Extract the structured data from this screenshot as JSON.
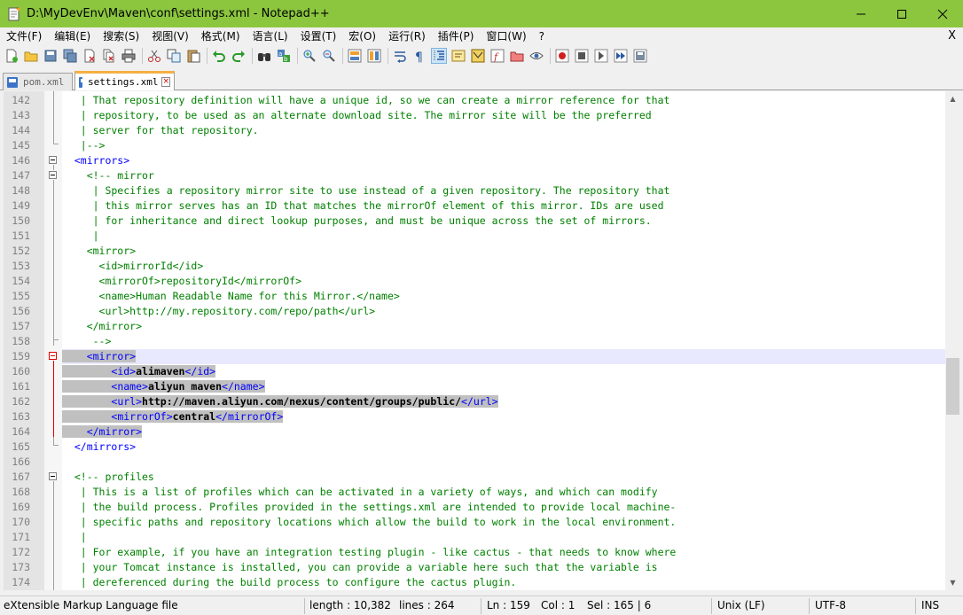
{
  "window": {
    "title": "D:\\MyDevEnv\\Maven\\conf\\settings.xml - Notepad++"
  },
  "menu": [
    "文件(F)",
    "编辑(E)",
    "搜索(S)",
    "视图(V)",
    "格式(M)",
    "语言(L)",
    "设置(T)",
    "宏(O)",
    "运行(R)",
    "插件(P)",
    "窗口(W)",
    "?"
  ],
  "menu_close": "X",
  "tabs": [
    {
      "label": "pom.xml",
      "active": false
    },
    {
      "label": "settings.xml",
      "active": true
    }
  ],
  "lines": [
    {
      "n": "142",
      "s": [
        [
          "c",
          "   | That repository definition will have a unique id, so we can create a mirror reference for that"
        ]
      ]
    },
    {
      "n": "143",
      "s": [
        [
          "c",
          "   | repository, to be used as an alternate download site. The mirror site will be the preferred"
        ]
      ]
    },
    {
      "n": "144",
      "s": [
        [
          "c",
          "   | server for that repository."
        ]
      ]
    },
    {
      "n": "145",
      "s": [
        [
          "c",
          "   |-->"
        ]
      ]
    },
    {
      "n": "146",
      "s": [
        [
          "t",
          "  <mirrors>"
        ]
      ]
    },
    {
      "n": "147",
      "s": [
        [
          "c",
          "    <!-- mirror"
        ]
      ]
    },
    {
      "n": "148",
      "s": [
        [
          "c",
          "     | Specifies a repository mirror site to use instead of a given repository. The repository that"
        ]
      ]
    },
    {
      "n": "149",
      "s": [
        [
          "c",
          "     | this mirror serves has an ID that matches the mirrorOf element of this mirror. IDs are used"
        ]
      ]
    },
    {
      "n": "150",
      "s": [
        [
          "c",
          "     | for inheritance and direct lookup purposes, and must be unique across the set of mirrors."
        ]
      ]
    },
    {
      "n": "151",
      "s": [
        [
          "c",
          "     |"
        ]
      ]
    },
    {
      "n": "152",
      "s": [
        [
          "c",
          "    <mirror>"
        ]
      ]
    },
    {
      "n": "153",
      "s": [
        [
          "c",
          "      <id>mirrorId</id>"
        ]
      ]
    },
    {
      "n": "154",
      "s": [
        [
          "c",
          "      <mirrorOf>repositoryId</mirrorOf>"
        ]
      ]
    },
    {
      "n": "155",
      "s": [
        [
          "c",
          "      <name>Human Readable Name for this Mirror.</name>"
        ]
      ]
    },
    {
      "n": "156",
      "s": [
        [
          "c",
          "      <url>http://my.repository.com/repo/path</url>"
        ]
      ]
    },
    {
      "n": "157",
      "s": [
        [
          "c",
          "    </mirror>"
        ]
      ]
    },
    {
      "n": "158",
      "s": [
        [
          "c",
          "     -->"
        ]
      ]
    },
    {
      "n": "159",
      "current": true,
      "sel": true,
      "s": [
        [
          "p",
          "    "
        ],
        [
          "t",
          "<mirror>"
        ]
      ]
    },
    {
      "n": "160",
      "sel": true,
      "s": [
        [
          "p",
          "        "
        ],
        [
          "t",
          "<id>"
        ],
        [
          "x",
          "alimaven"
        ],
        [
          "t",
          "</id>"
        ]
      ]
    },
    {
      "n": "161",
      "sel": true,
      "s": [
        [
          "p",
          "        "
        ],
        [
          "t",
          "<name>"
        ],
        [
          "x",
          "aliyun maven"
        ],
        [
          "t",
          "</name>"
        ]
      ]
    },
    {
      "n": "162",
      "sel": true,
      "s": [
        [
          "p",
          "        "
        ],
        [
          "t",
          "<url>"
        ],
        [
          "x",
          "http://maven.aliyun.com/nexus/content/groups/public/"
        ],
        [
          "t",
          "</url>"
        ]
      ]
    },
    {
      "n": "163",
      "sel": true,
      "s": [
        [
          "p",
          "        "
        ],
        [
          "t",
          "<mirrorOf>"
        ],
        [
          "x",
          "central"
        ],
        [
          "t",
          "</mirrorOf>"
        ]
      ]
    },
    {
      "n": "164",
      "sel": true,
      "s": [
        [
          "p",
          "    "
        ],
        [
          "t",
          "</mirror>"
        ]
      ]
    },
    {
      "n": "165",
      "s": [
        [
          "t",
          "  </mirrors>"
        ]
      ]
    },
    {
      "n": "166",
      "s": [
        [
          "p",
          ""
        ]
      ]
    },
    {
      "n": "167",
      "s": [
        [
          "c",
          "  <!-- profiles"
        ]
      ]
    },
    {
      "n": "168",
      "s": [
        [
          "c",
          "   | This is a list of profiles which can be activated in a variety of ways, and which can modify"
        ]
      ]
    },
    {
      "n": "169",
      "s": [
        [
          "c",
          "   | the build process. Profiles provided in the settings.xml are intended to provide local machine-"
        ]
      ]
    },
    {
      "n": "170",
      "s": [
        [
          "c",
          "   | specific paths and repository locations which allow the build to work in the local environment."
        ]
      ]
    },
    {
      "n": "171",
      "s": [
        [
          "c",
          "   |"
        ]
      ]
    },
    {
      "n": "172",
      "s": [
        [
          "c",
          "   | For example, if you have an integration testing plugin - like cactus - that needs to know where"
        ]
      ]
    },
    {
      "n": "173",
      "s": [
        [
          "c",
          "   | your Tomcat instance is installed, you can provide a variable here such that the variable is"
        ]
      ]
    },
    {
      "n": "174",
      "s": [
        [
          "c",
          "   | dereferenced during the build process to configure the cactus plugin."
        ]
      ]
    }
  ],
  "status": {
    "filetype": "eXtensible Markup Language file",
    "length": "length : 10,382",
    "lines": "lines : 264",
    "ln": "Ln : 159",
    "col": "Col : 1",
    "sel": "Sel : 165 | 6",
    "eol": "Unix (LF)",
    "encoding": "UTF-8",
    "mode": "INS"
  },
  "colors": {
    "titlebar": "#8cc63f",
    "comment": "#008000",
    "tag": "#0000ff",
    "selection": "#c0c0c0",
    "current_line": "#e8e8ff",
    "fold_marker_active": "#e00000"
  }
}
